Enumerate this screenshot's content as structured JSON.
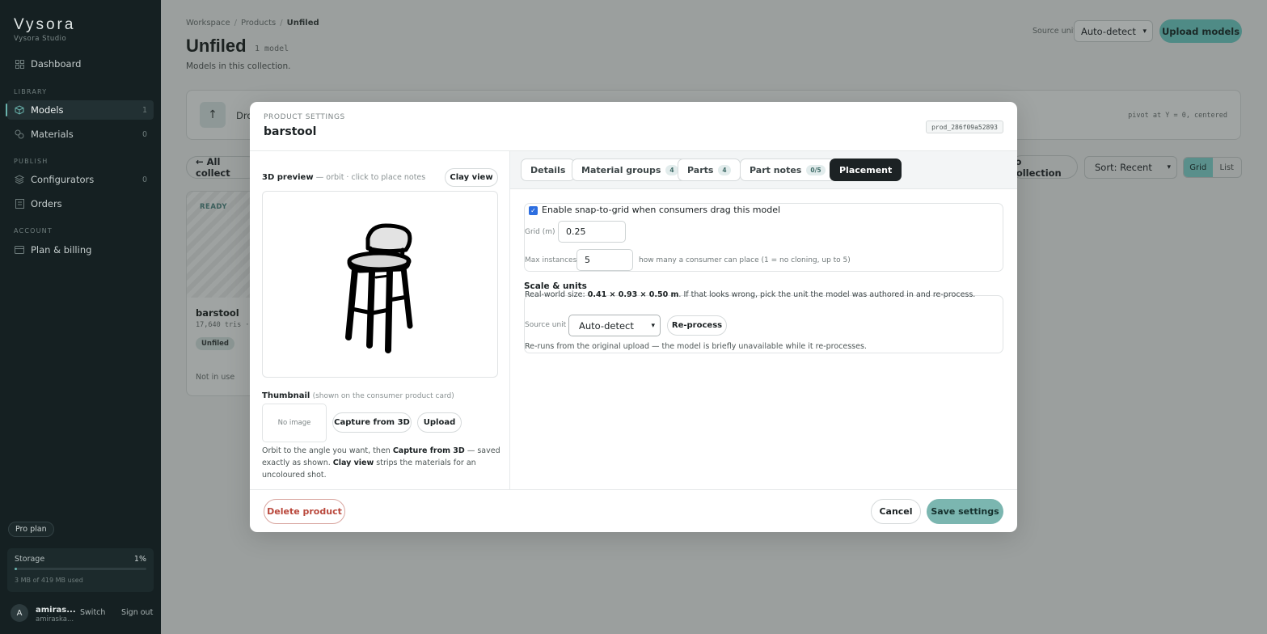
{
  "sidebar": {
    "brand": "Vysora",
    "brand_sub": "Vysora Studio",
    "dashboard": "Dashboard",
    "section_library": "LIBRARY",
    "models": "Models",
    "models_count": "1",
    "materials": "Materials",
    "materials_count": "0",
    "section_publish": "PUBLISH",
    "configurators": "Configurators",
    "configurators_count": "0",
    "orders": "Orders",
    "section_account": "ACCOUNT",
    "plan_billing": "Plan & billing",
    "plan_badge": "Pro plan",
    "storage_label": "Storage",
    "storage_pct": "1%",
    "storage_fraction": 0.01,
    "storage_used": "3 MB of 419 MB used",
    "avatar_letter": "A",
    "user_name": "amiras...",
    "user_email": "amiraska...",
    "switch": "Switch",
    "sign_out": "Sign out"
  },
  "header": {
    "breadcrumb": [
      "Workspace",
      "Products",
      "Unfiled"
    ],
    "title": "Unfiled",
    "count": "1 model",
    "description": "Models in this collection.",
    "source_unit_label": "Source unit",
    "source_unit_value": "Auto-detect",
    "upload_button": "Upload models"
  },
  "background": {
    "drop_text": "Dro",
    "pivot_note": "pivot at Y = 0, centered",
    "all_collections": "← All collect",
    "to_collection": "to collection",
    "sort": "Sort: Recent",
    "view_grid": "Grid",
    "view_list": "List",
    "card": {
      "status": "READY",
      "name": "barstool",
      "tris": "17,640 tris ·",
      "tag": "Unfiled",
      "usage": "Not in use"
    }
  },
  "modal": {
    "kicker": "PRODUCT SETTINGS",
    "title": "barstool",
    "product_id": "prod_286f09a52893",
    "preview_title": "3D preview",
    "preview_hint": "— orbit · click to place notes",
    "clay_view": "Clay view",
    "thumbnail_title": "Thumbnail",
    "thumbnail_hint": "(shown on the consumer product card)",
    "no_image": "No image",
    "capture_button": "Capture from 3D",
    "upload_button": "Upload",
    "help_1": "Orbit to the angle you want, then ",
    "help_capture": "Capture from 3D",
    "help_2": " — saved exactly as shown. ",
    "help_clay": "Clay view",
    "help_3": " strips the materials for an uncoloured shot.",
    "tabs": [
      {
        "label": "Details",
        "badge": ""
      },
      {
        "label": "Material groups",
        "badge": "4"
      },
      {
        "label": "Parts",
        "badge": "4"
      },
      {
        "label": "Part notes",
        "badge": "0/5"
      },
      {
        "label": "Placement",
        "badge": ""
      }
    ],
    "active_tab": "Placement",
    "placement": {
      "snap_label": "Enable snap-to-grid when consumers drag this model",
      "snap_checked": true,
      "grid_label": "Grid (m)",
      "grid_value": "0.25",
      "max_label": "Max instances",
      "max_value": "5",
      "max_hint": "how many a consumer can place (1 = no cloning, up to 5)"
    },
    "scale": {
      "title": "Scale & units",
      "size_prefix": "Real-world size: ",
      "size_value": "0.41 × 0.93 × 0.50 m",
      "size_suffix": ". If that looks wrong, pick the unit the model was authored in and re-process.",
      "source_label": "Source unit",
      "source_value": "Auto-detect",
      "reprocess": "Re-process",
      "note": "Re-runs from the original upload — the model is briefly unavailable while it re-processes."
    },
    "delete": "Delete product",
    "cancel": "Cancel",
    "save": "Save settings"
  },
  "colors": {
    "accent": "#7bb6b0",
    "sidebar_bg": "#152022",
    "checkbox": "#2d6ee0",
    "danger": "#b9473b"
  }
}
